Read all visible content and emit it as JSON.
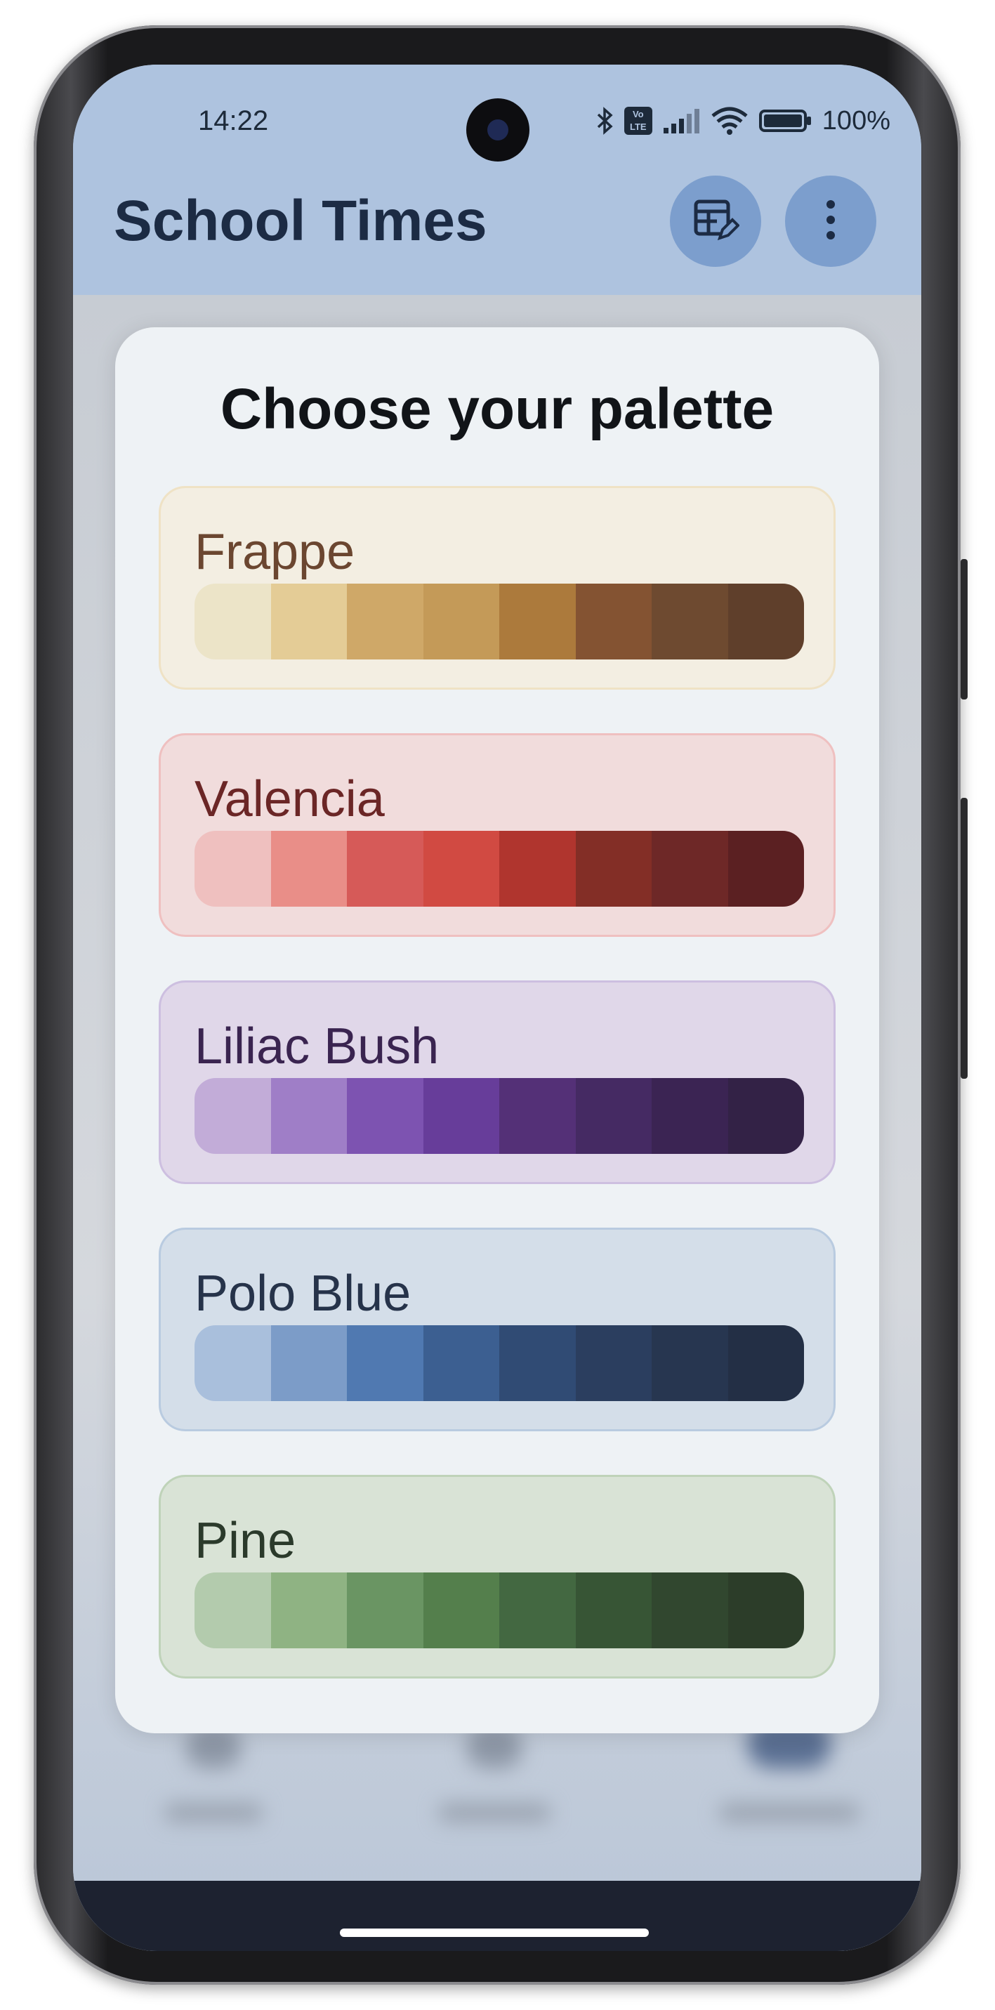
{
  "status_bar": {
    "time": "14:22",
    "battery": "100%",
    "volte_label": "Vo LTE",
    "icons": [
      "bluetooth-icon",
      "volte-icon",
      "signal-icon",
      "wifi-icon",
      "battery-icon"
    ]
  },
  "app_bar": {
    "title": "School Times",
    "edit_timetable_icon": "table-edit-icon",
    "more_icon": "more-vertical-icon",
    "background": "#aec3df"
  },
  "dialog": {
    "title": "Choose your palette",
    "palettes": [
      {
        "name": "Frappe",
        "text_color": "#6b4630",
        "background": "#f3eee2",
        "border": "#efe2c5",
        "colors": [
          "#ece4c8",
          "#e4cc96",
          "#cfa868",
          "#c49a58",
          "#ac7a3c",
          "#845332",
          "#6e4a30",
          "#5f3f2b"
        ]
      },
      {
        "name": "Valencia",
        "text_color": "#6b2626",
        "background": "#f1dcdc",
        "border": "#efc0c0",
        "colors": [
          "#efc0bf",
          "#e98e88",
          "#d65a58",
          "#d14a42",
          "#b0352e",
          "#832e26",
          "#6e2827",
          "#5b2022"
        ]
      },
      {
        "name": "Liliac Bush",
        "text_color": "#3a2450",
        "background": "#e0d7e9",
        "border": "#cdbfe0",
        "colors": [
          "#c2acd8",
          "#9f7ec7",
          "#7d53b1",
          "#673d9a",
          "#543077",
          "#452a63",
          "#3b2453",
          "#332246"
        ]
      },
      {
        "name": "Polo Blue",
        "text_color": "#26334a",
        "background": "#d4dee9",
        "border": "#b9cbe0",
        "colors": [
          "#a9bfdc",
          "#7c9cc8",
          "#5079b1",
          "#3c5f91",
          "#304b74",
          "#2b3e5f",
          "#273650",
          "#232f45"
        ]
      },
      {
        "name": "Pine",
        "text_color": "#2b3a2b",
        "background": "#d9e3d6",
        "border": "#bfd3b9",
        "colors": [
          "#b3cbad",
          "#8fb383",
          "#6a9563",
          "#547f4c",
          "#436841",
          "#375535",
          "#31472f",
          "#2c3d29"
        ]
      }
    ]
  }
}
